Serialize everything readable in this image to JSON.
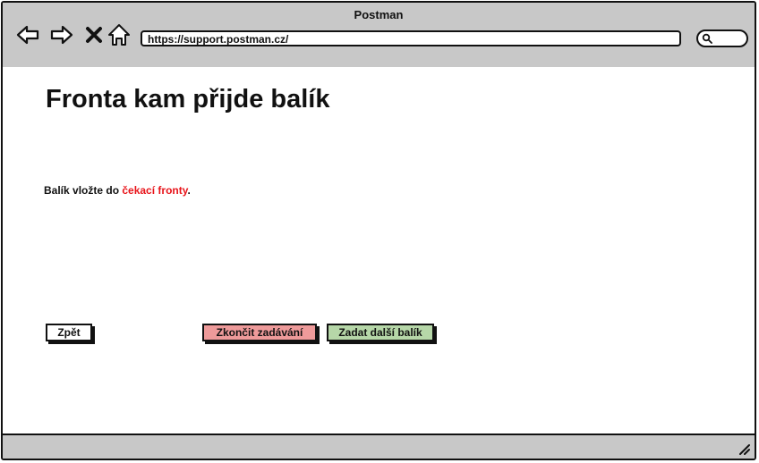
{
  "window": {
    "title": "Postman"
  },
  "browser": {
    "url": "https://support.postman.cz/",
    "nav_icons": [
      "back-arrow-icon",
      "forward-arrow-icon",
      "close-x-icon",
      "home-icon"
    ],
    "search_icon": "search-icon"
  },
  "page": {
    "title": "Fronta kam přijde balík",
    "instruction_prefix": "Balík vložte do ",
    "instruction_highlight": "čekací fronty",
    "instruction_suffix": ".",
    "highlight_color": "#e8141a"
  },
  "buttons": {
    "back_label": "Zpět",
    "finish_label": "Zkončit zadávání",
    "next_label": "Zadat další balík",
    "finish_color": "#ee9a9a",
    "next_color": "#b6d7a8"
  }
}
